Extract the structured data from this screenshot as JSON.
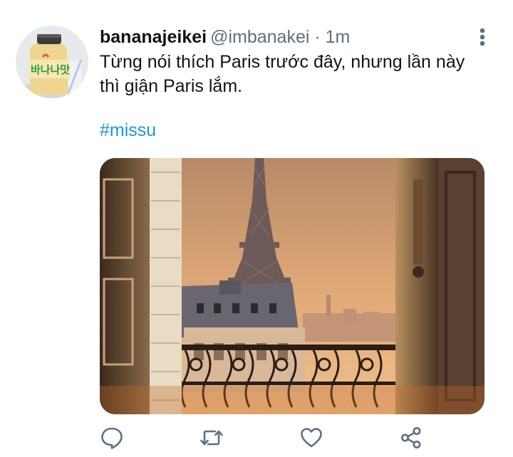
{
  "tweet": {
    "display_name": "bananajeikei",
    "handle": "@imbanakei",
    "separator": " · ",
    "timestamp": "1m",
    "text": "Từng nói thích Paris trước đây, nhưng lần này thì giận Paris lắm.",
    "hashtag": "#missu",
    "avatar": {
      "bottle_label": "바나나맛",
      "label_color": "#2e9b3a",
      "bottle_color": "#efd68e"
    },
    "media": {
      "description_icon": "eiffel-tower-photo"
    }
  },
  "icons": {
    "more": "more-vertical-icon",
    "reply": "reply-icon",
    "retweet": "retweet-icon",
    "like": "like-icon",
    "share": "share-icon"
  },
  "colors": {
    "text": "#0f1419",
    "secondary": "#5b7083",
    "accent": "#1b95e0",
    "icon": "#5b7083"
  }
}
